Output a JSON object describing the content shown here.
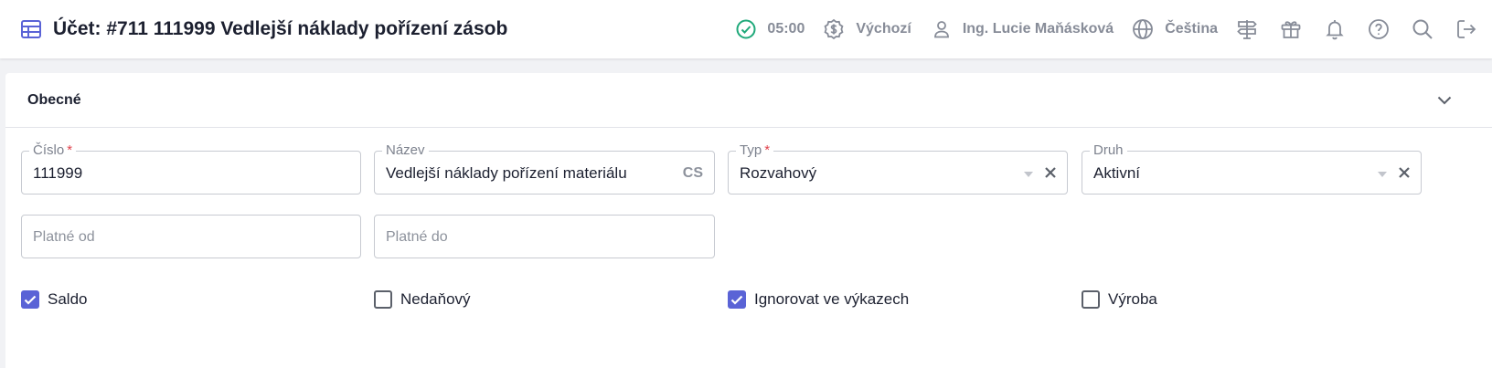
{
  "header": {
    "title": "Účet: #711 111999 Vedlejší náklady pořízení zásob",
    "title_icon": "table-icon"
  },
  "toolbar": {
    "time": "05:00",
    "company": "Výchozí",
    "user": "Ing. Lucie Maňásková",
    "language": "Čeština",
    "icons": [
      "check-circle-icon",
      "dollar-circle-icon",
      "user-icon",
      "globe-icon",
      "signpost-icon",
      "gift-icon",
      "bell-icon",
      "help-icon",
      "search-icon",
      "logout-icon"
    ]
  },
  "section": {
    "title": "Obecné"
  },
  "form": {
    "cislo": {
      "label": "Číslo",
      "required_mark": "*",
      "value": "111999"
    },
    "nazev": {
      "label": "Název",
      "value": "Vedlejší náklady pořízení materiálu",
      "lang_suffix": "CS"
    },
    "typ": {
      "label": "Typ",
      "required_mark": "*",
      "value": "Rozvahový"
    },
    "druh": {
      "label": "Druh",
      "value": "Aktivní"
    },
    "platne_od": {
      "placeholder": "Platné od"
    },
    "platne_do": {
      "placeholder": "Platné do"
    }
  },
  "checkboxes": [
    {
      "label": "Saldo",
      "checked": true
    },
    {
      "label": "Nedaňový",
      "checked": false
    },
    {
      "label": "Ignorovat ve výkazech",
      "checked": true
    },
    {
      "label": "Výroba",
      "checked": false
    }
  ],
  "colors": {
    "accent": "#5a63d6",
    "status_ok": "#1fa97a",
    "required": "#e0424c",
    "muted": "#878c98"
  }
}
